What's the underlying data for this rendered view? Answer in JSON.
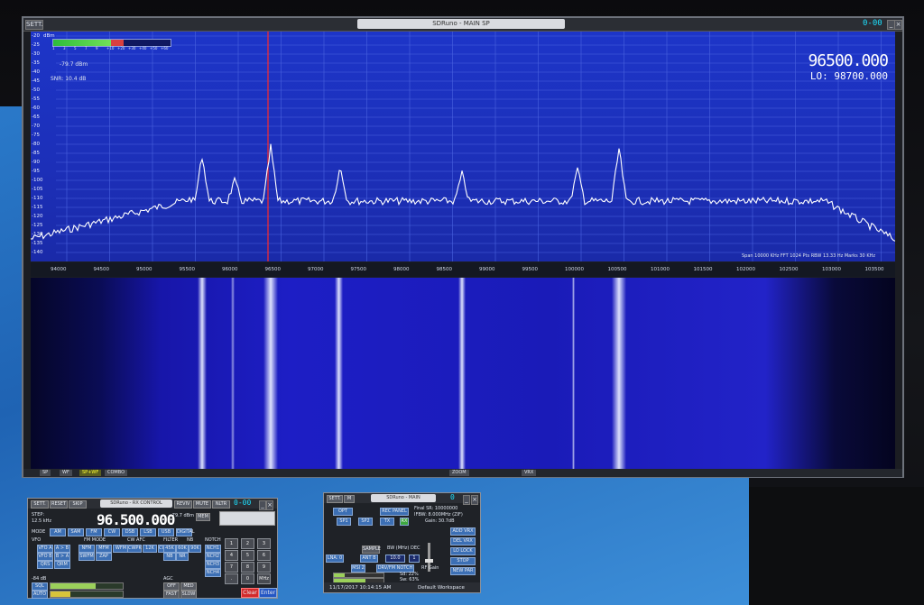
{
  "main_window": {
    "title": "SDRuno - MAIN SP",
    "btn_sett": "SETT.",
    "digits": "0-00",
    "signal_level": "-79.7 dBm",
    "snr": "SNR: 10.4 dB",
    "dbm_unit": "dBm",
    "center_freq": "96500.000",
    "lo_label": "LO:",
    "lo_freq": "98700.000",
    "smeter_ticks": [
      "1",
      "3",
      "5",
      "7",
      "9",
      "+10",
      "+20",
      "+30",
      "+40",
      "+50",
      "+60"
    ],
    "y_ticks": [
      "-20",
      "-25",
      "-30",
      "-35",
      "-40",
      "-45",
      "-50",
      "-55",
      "-60",
      "-65",
      "-70",
      "-75",
      "-80",
      "-85",
      "-90",
      "-95",
      "-100",
      "-105",
      "-110",
      "-115",
      "-120",
      "-125",
      "-130",
      "-135",
      "-140"
    ],
    "x_ticks": [
      "94000",
      "94500",
      "95000",
      "95500",
      "96000",
      "96500",
      "97000",
      "97500",
      "98000",
      "98500",
      "99000",
      "99500",
      "100000",
      "100500",
      "101000",
      "101500",
      "102000",
      "102500",
      "103000",
      "103500"
    ],
    "span_info": "Span 10000 KHz  FFT 1024 Pts  RBW 13.33 Hz  Marks 30 KHz",
    "bottom_buttons": [
      "SP",
      "WF",
      "SP+WF",
      "COMBO"
    ],
    "zoom_label": "ZOOM",
    "vrx_label": "VRX"
  },
  "rx_window": {
    "title": "SDRuno - RX CONTROL",
    "buttons_top": [
      "SETT.",
      "RESET",
      "SKIP"
    ],
    "buttons_top_right": [
      "REVIV",
      "MUTE",
      "NLTR"
    ],
    "digits": "0-00",
    "step_label": "STEP:",
    "step_value": "12.5 kHz",
    "mem_label": "MEM",
    "frequency": "96.500.000",
    "level": "-79.7 dBm",
    "mode_label": "MODE",
    "modes": [
      "AM",
      "SAM",
      "FM",
      "CW",
      "DSB",
      "LSB",
      "USB",
      "DIGITAL"
    ],
    "vfo_label": "VFO",
    "vfo_buttons": [
      "VFO A",
      "A > B",
      "VFO B",
      "B > A",
      "QRS",
      "QRM"
    ],
    "fm_mode_label": "FM MODE",
    "fm_modes": [
      "NFM",
      "MFM",
      "WFM",
      "SWFM",
      "ZAP"
    ],
    "cw_label": "CW AFC",
    "cw_buttons": [
      "CWPK",
      "12K",
      "CWAFC"
    ],
    "filter_label": "FILTER",
    "filters": [
      "45K",
      "60K",
      "90K",
      "NB",
      "NR"
    ],
    "nb_label": "NB",
    "notch_label": "NOTCH",
    "notch_buttons": [
      "NCH1",
      "NCH2",
      "NCH3",
      "NCH4"
    ],
    "sq_label": "-84 dB",
    "squelch": "SQL",
    "agc_label": "AGC",
    "agc_buttons": [
      "OFF",
      "MED",
      "FAST",
      "SLOW"
    ],
    "auto": "AUTO",
    "keypad": [
      "1",
      "2",
      "3",
      "4",
      "5",
      "6",
      "7",
      "8",
      "9",
      ".",
      "0",
      "MHz"
    ],
    "clear": "Clear",
    "enter": "Enter"
  },
  "main_ctrl_window": {
    "title": "SDRuno - MAIN",
    "digits": "0",
    "buttons": [
      "OPT",
      "REC PANEL",
      "SP1",
      "SP2",
      "TX",
      "RX"
    ],
    "final_sr": "Final SR: 10000000",
    "ifbw": "IFBW: 8.000MHz (ZIF)",
    "gain": "Gain: 30.7dB",
    "side_buttons": [
      "ADD VRX",
      "DEL VRX",
      "LO LOCK",
      "STOP",
      "NEW PAR"
    ],
    "bw_label": "BW (MHz)",
    "bw_value": "10.0",
    "dec_label": "DEC",
    "dec_value": "1",
    "rf_gain": "RF Gain",
    "sample_label": "SAMPLE",
    "sample_btn": "MSI 2",
    "dc_btn": "DRV/FM NOTCH",
    "lna_btn": "LNA: 0",
    "ant_btn": "ANT B",
    "sd": "Sd: 22%",
    "sw": "Sw: 63%",
    "datetime": "11/17/2017 10:14:15 AM",
    "workspace": "Default Workspace"
  },
  "colors": {
    "spectrum_bg": "#1d35c8",
    "trace": "#ffffff",
    "marker": "#ff2a2a",
    "accent": "#1de1ff"
  }
}
